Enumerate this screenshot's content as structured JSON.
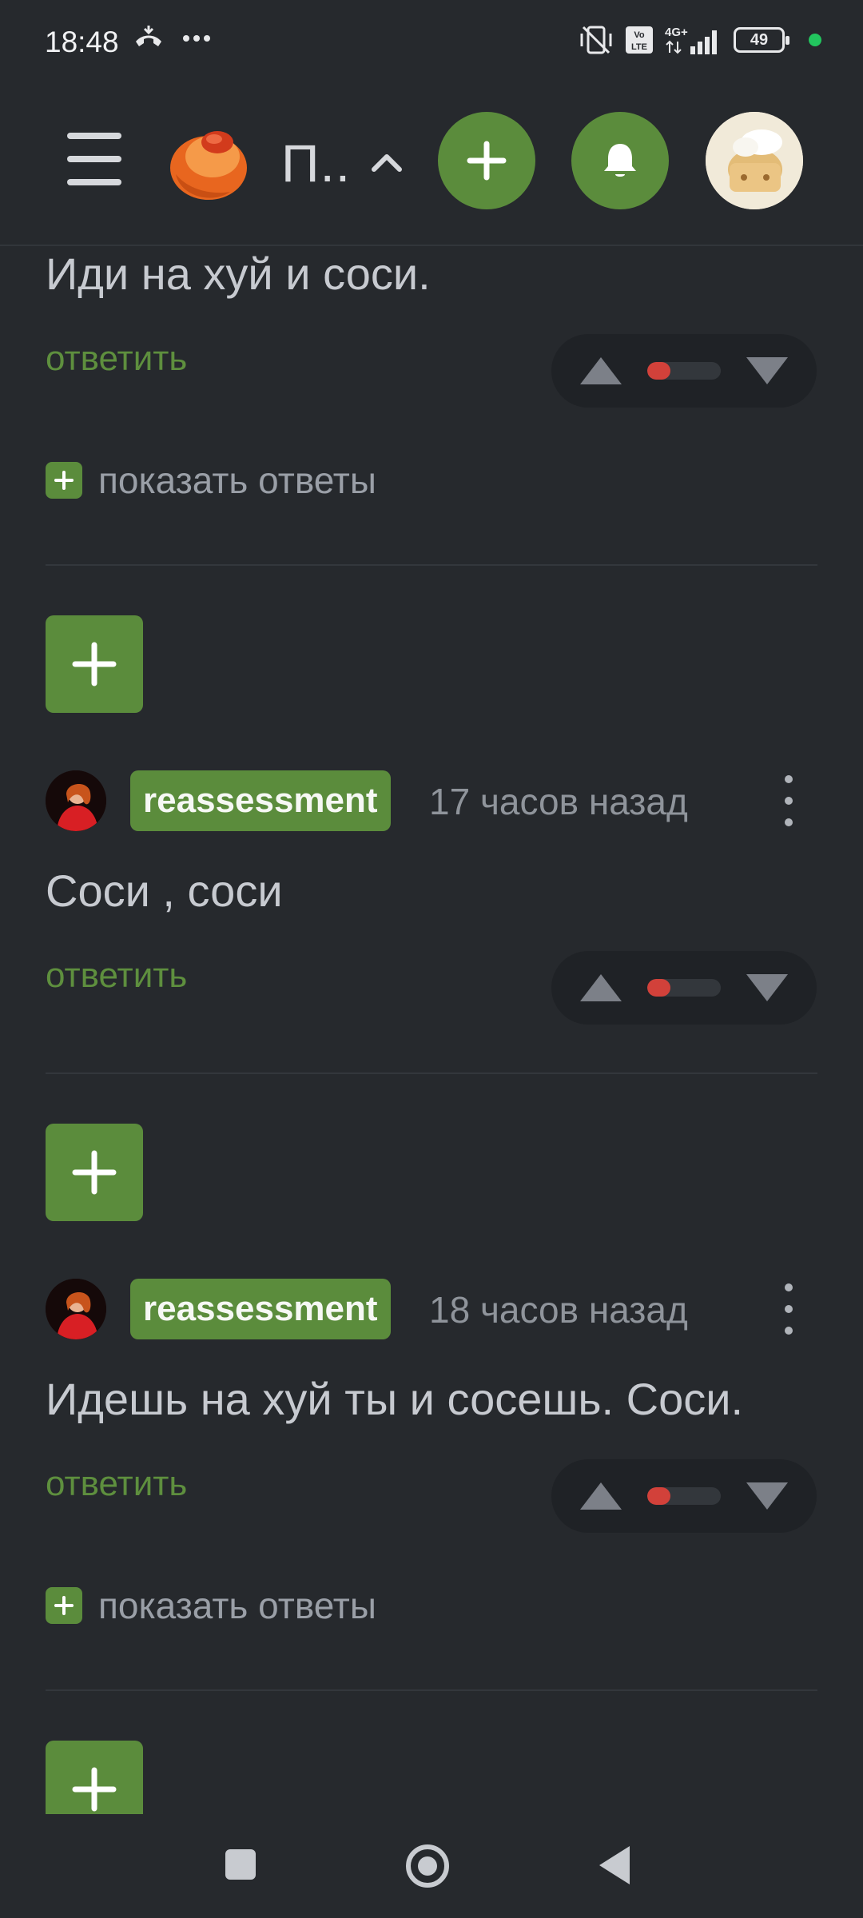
{
  "status_bar": {
    "time": "18:48",
    "icons_left": [
      "call-end-icon",
      "more-dots-icon"
    ],
    "icons_right": [
      "vibrate-off-icon",
      "volte-icon",
      "signal-4g-icon"
    ],
    "network_label": "4G+",
    "volte_label": "Vo LTE",
    "battery_level": "49"
  },
  "header": {
    "community_title": "П..",
    "colors": {
      "accent": "#5b8c3c",
      "background": "#26292d"
    }
  },
  "comments": [
    {
      "text": "Иди на хуй и соси.",
      "reply_label": "ответить",
      "show_replies_label": "показать ответы",
      "rating_fraction": 0.32
    },
    {
      "username": "reassessment",
      "timestamp": "17 часов назад",
      "text": "Соси , соси",
      "reply_label": "ответить",
      "rating_fraction": 0.32
    },
    {
      "username": "reassessment",
      "timestamp": "18 часов назад",
      "text": "Идешь на хуй ты и сосешь. Соси.",
      "reply_label": "ответить",
      "show_replies_label": "показать ответы",
      "rating_fraction": 0.32
    }
  ],
  "colors": {
    "accent_green": "#5b8c3c",
    "reply_green": "#5e8f3e",
    "vote_red": "#d2413a"
  }
}
